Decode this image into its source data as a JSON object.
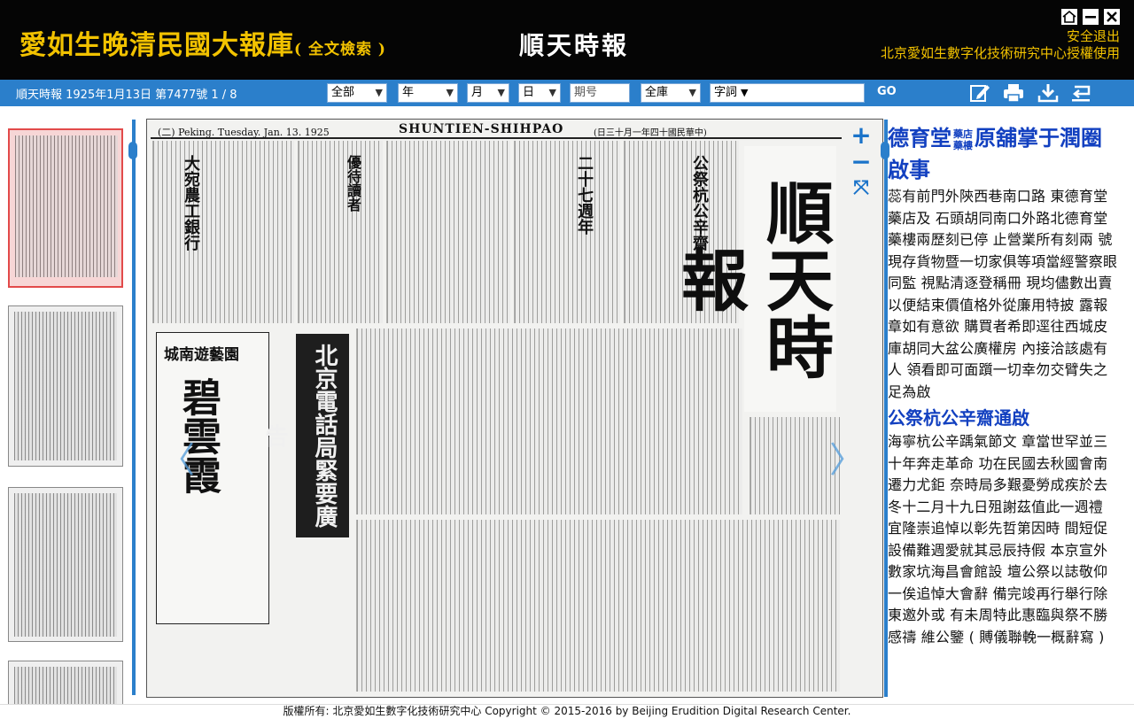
{
  "header": {
    "brand": "愛如生晚清民國大報庫",
    "brand_sub": "( 全文檢索 )",
    "paper_name": "順天時報",
    "logout": "安全退出",
    "license": "北京愛如生數字化技術研究中心授權使用"
  },
  "toolbar": {
    "issue_info": "順天時報 1925年1月13日 第7477號 1 / 8",
    "scope": "全部",
    "year": "年",
    "month": "月",
    "day": "日",
    "issue_no_placeholder": "期号",
    "fulltext": "全庫",
    "field": "字詞",
    "go_label": "GO"
  },
  "icons": {
    "edit": "edit-icon",
    "print": "print-icon",
    "download": "download-icon",
    "return": "return-icon",
    "home": "home-icon",
    "minimize": "minimize-icon",
    "close": "close-icon"
  },
  "viewer": {
    "zoom_in": "+",
    "zoom_out": "−",
    "fit": "⤧",
    "prev": "〈",
    "next": "〉"
  },
  "newspaper": {
    "masthead": "順天時報",
    "header_left": "(二)   Peking.  Tuesday.  Jan. 13.  1925",
    "header_center": "SHUNTIEN-SHIHPAO",
    "header_right": "(日三十月一年四十國民華中)",
    "ad_title": "城南遊藝園",
    "ad_big": "碧雲霞",
    "dark_ad": "北京電話局緊要廣告"
  },
  "article": {
    "title": "德育堂",
    "title_small_1": "藥店",
    "title_small_2": "藥樓",
    "title_rest": "原舖掌于潤圈啟事",
    "body": "蕊有前門外陝西巷南口路 東德育堂藥店及  石頭胡同南口外路北德育堂藥樓兩歷刻已停  止營業所有刻兩 號現存貨物暨一切家俱等項當經警察眼同監  視點清逐登稱冊  現均儘數出賣以便結束價值格外從廉用特披  露報章如有意欲  購買者希即逕往西城皮庫胡同大盆公廣權房  內接洽該處有人  領看即可面躓一切幸勿交臂失之足為啟",
    "title2": "公祭杭公辛齋通啟",
    "body2": "海寧杭公辛踽氣節文  章當世罕並三十年奔走革命  功在民國去秋國會南遷力尤鉅  奈時局多艱憂勞成疾於去冬十二月十九日殂謝茲值此一週禮 宜隆崇追悼以彰先哲第因時  間短促設備難週愛就其忌辰持假  本京宣外數家坑海昌會館設  壇公祭以誌敬仰一俟追悼大會辭  備完竣再行舉行除東邀外或  有未周特此惠臨與祭不勝感禱  維公鑒 ( 賻儀聯輓一概辭寫 )"
  },
  "footer": {
    "copyright": "版權所有: 北京愛如生數字化技術研究中心 Copyright © 2015-2016 by Beijing Erudition Digital Research Center."
  },
  "colors": {
    "header_bg": "#050505",
    "brand_gold": "#f2c200",
    "toolbar_blue": "#2b7fcb",
    "title_blue": "#1240c0",
    "active_thumb": "#e24a4a"
  }
}
